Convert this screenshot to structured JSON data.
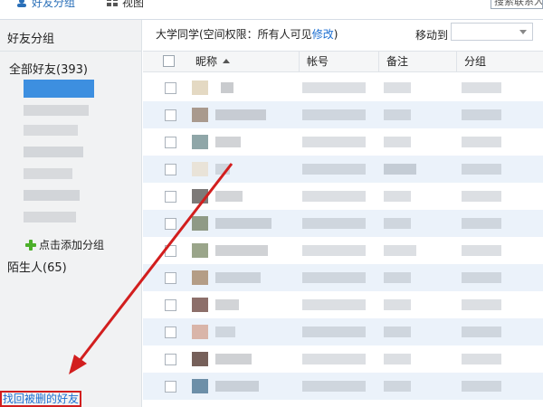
{
  "topbar": {
    "tab_friends": "好友分组",
    "tab_view": "视图",
    "search_placeholder": "搜索联系人"
  },
  "sidebar": {
    "title": "好友分组",
    "group_all": "全部好友(393)",
    "add_group": "点击添加分组",
    "strangers": "陌生人(65)",
    "recover": "找回被删的好友"
  },
  "main": {
    "crumb_text": "大学同学(空间权限：所有人可见",
    "crumb_link": "修改",
    "crumb_close": ")",
    "move_to": "移动到",
    "move_value": ""
  },
  "table": {
    "columns": [
      "昵称",
      "帐号",
      "备注",
      "分组"
    ]
  },
  "colors": {
    "accent": "#1d6fd1",
    "selection": "#3d8fe0",
    "highlight_red": "#d21e1e",
    "row_alt": "#ebf2fa"
  }
}
